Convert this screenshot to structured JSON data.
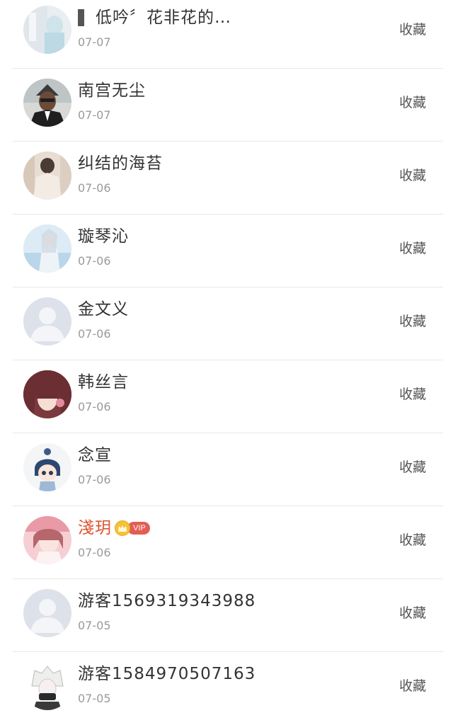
{
  "list": {
    "items": [
      {
        "name": "低吟〞花非花的…",
        "date": "07-07",
        "action": "收藏",
        "avatar": "avatar-photo-light"
      },
      {
        "name": "南宫无尘",
        "date": "07-07",
        "action": "收藏",
        "avatar": "avatar-photo-man"
      },
      {
        "name": "纠结的海苔",
        "date": "07-06",
        "action": "收藏",
        "avatar": "avatar-photo-beige"
      },
      {
        "name": "璇琴沁",
        "date": "07-06",
        "action": "收藏",
        "avatar": "avatar-photo-blue"
      },
      {
        "name": "金文义",
        "date": "07-06",
        "action": "收藏",
        "avatar": "default-avatar"
      },
      {
        "name": "韩丝言",
        "date": "07-06",
        "action": "收藏",
        "avatar": "avatar-anime-girl"
      },
      {
        "name": "念宣",
        "date": "07-06",
        "action": "收藏",
        "avatar": "avatar-cartoon"
      },
      {
        "name": "淺玥",
        "date": "07-06",
        "action": "收藏",
        "avatar": "avatar-photo-pink",
        "badge": "VIP"
      },
      {
        "name": "游客1569319343988",
        "date": "07-05",
        "action": "收藏",
        "avatar": "default-avatar"
      },
      {
        "name": "游客1584970507163",
        "date": "07-05",
        "action": "收藏",
        "avatar": "avatar-anime-boy"
      }
    ]
  },
  "colors": {
    "vip_name": "#e0522f",
    "vip_badge": "#e35d54",
    "default_avatar_bg": "#dde1ea"
  }
}
